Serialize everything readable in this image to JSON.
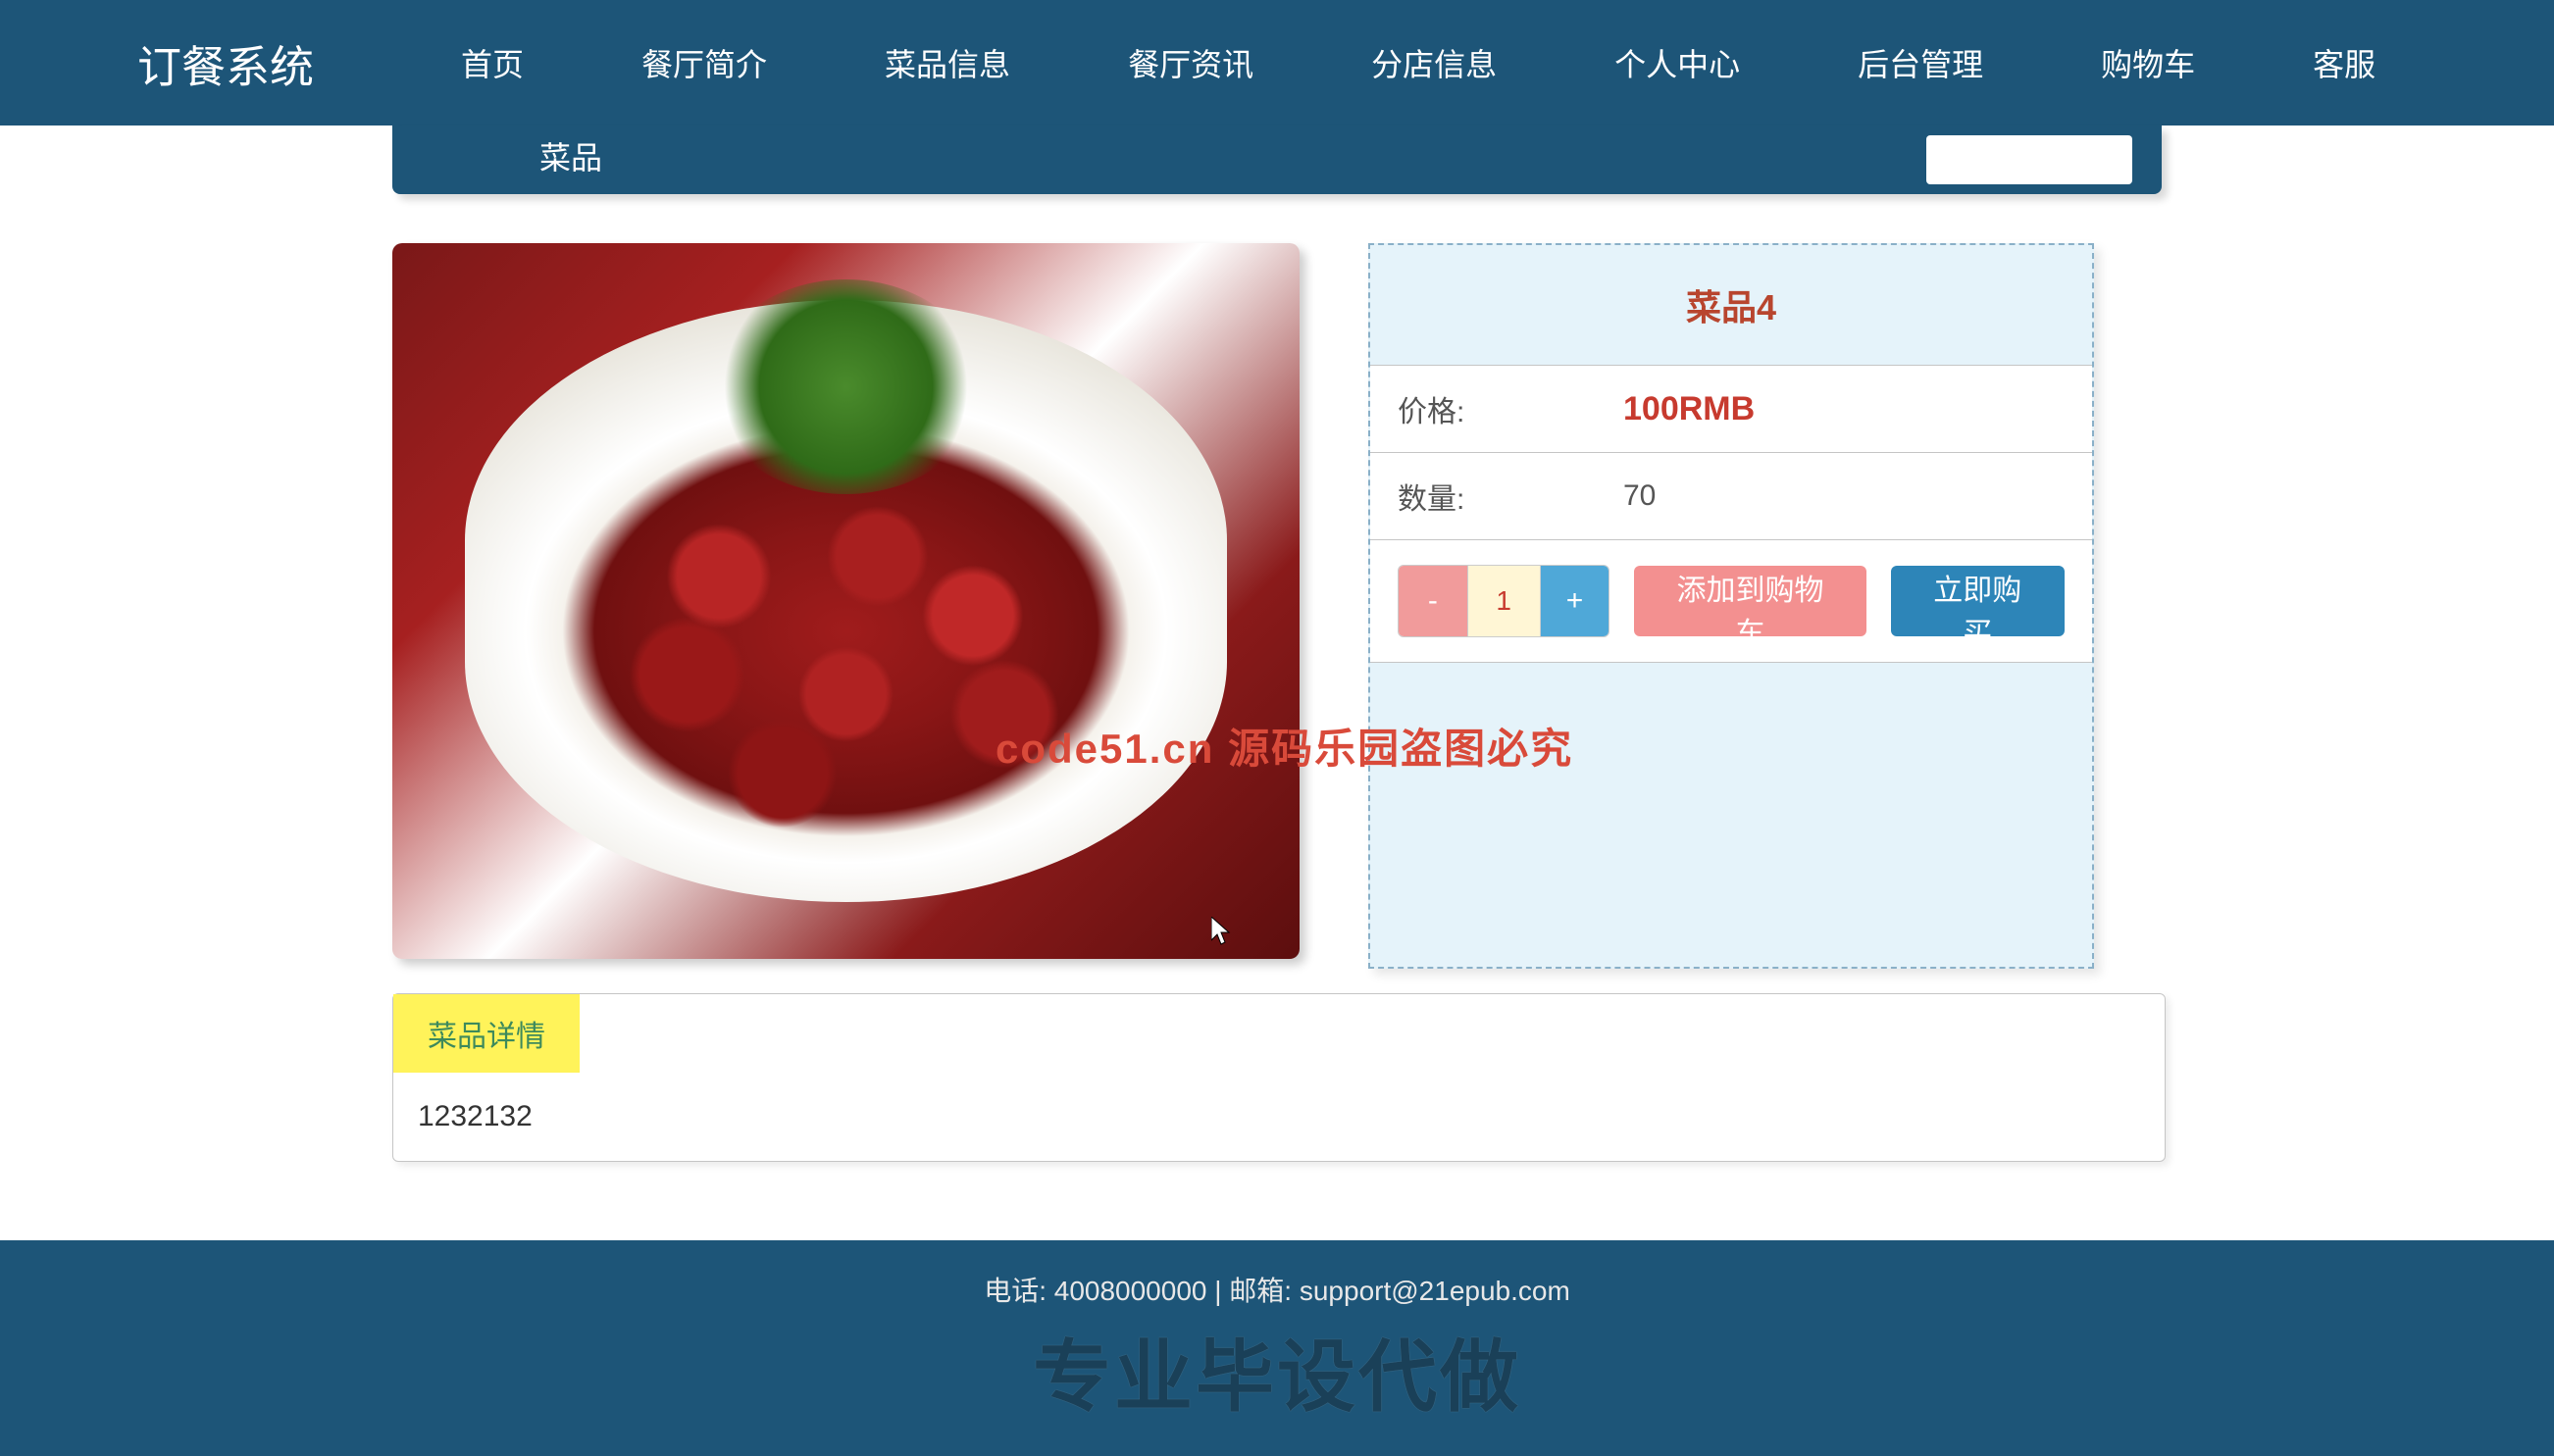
{
  "brand": "订餐系统",
  "nav": {
    "items": [
      "首页",
      "餐厅简介",
      "菜品信息",
      "餐厅资讯",
      "分店信息",
      "个人中心",
      "后台管理",
      "购物车",
      "客服"
    ]
  },
  "tabs": {
    "item1": "",
    "item2": "菜品"
  },
  "product": {
    "title": "菜品4",
    "price_label": "价格:",
    "price_value": "100RMB",
    "qty_label": "数量:",
    "qty_value": "70",
    "quantity_input": "1",
    "minus": "-",
    "plus": "+",
    "add_cart": "添加到购物车",
    "buy_now": "立即购买"
  },
  "detail": {
    "tab_label": "菜品详情",
    "content": "1232132"
  },
  "watermark": "code51.cn   源码乐园盗图必究",
  "footer": {
    "contact": "电话:   4008000000 | 邮箱:   support@21epub.com",
    "big_text": "专业毕设代做"
  }
}
